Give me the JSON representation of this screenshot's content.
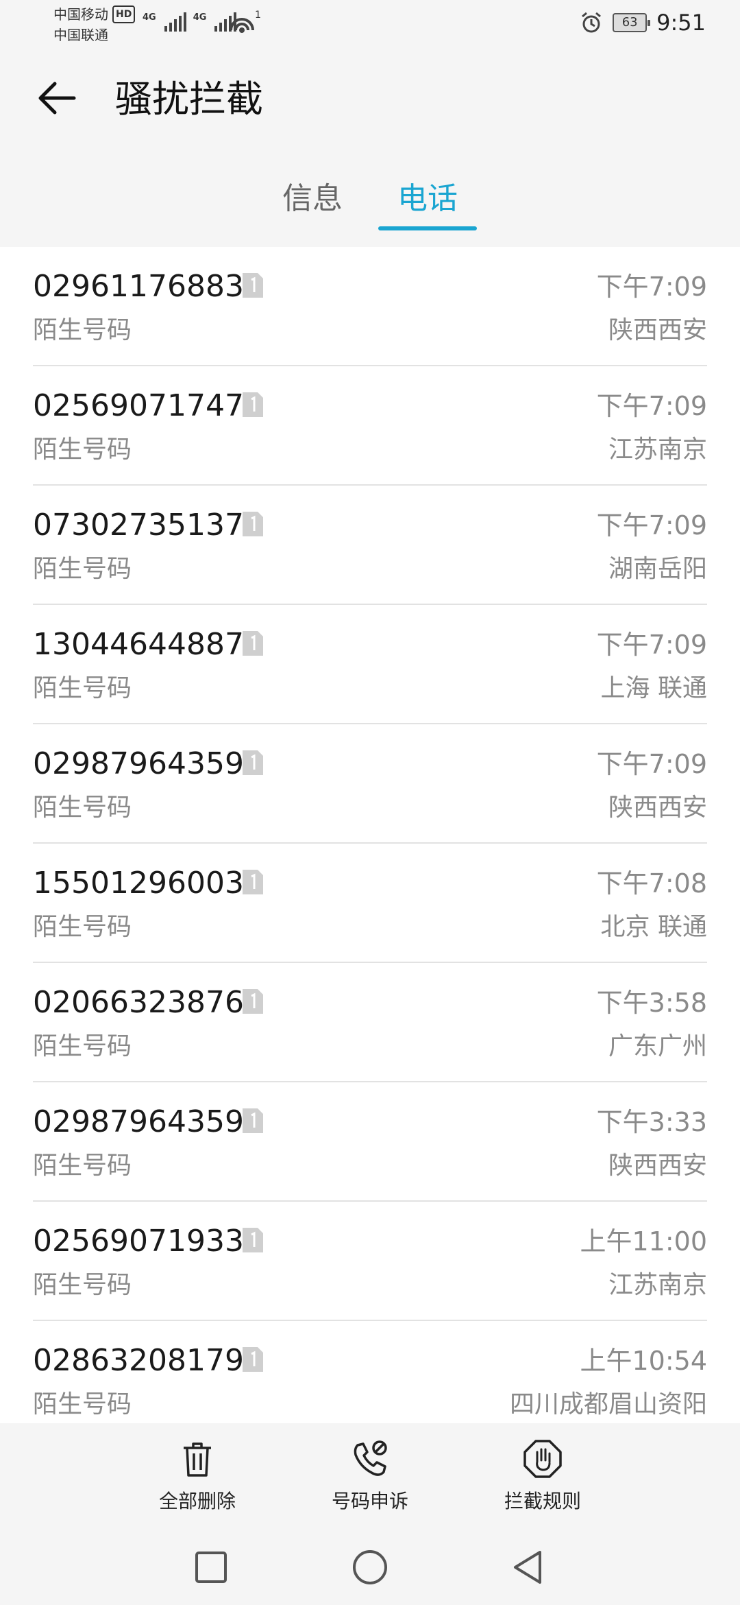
{
  "status_bar": {
    "carrier1": "中国移动",
    "carrier2": "中国联通",
    "hd": "HD",
    "net1": "4G",
    "net2": "4G",
    "hotspot_count": "1",
    "battery": "63",
    "time": "9:51"
  },
  "header": {
    "title": "骚扰拦截"
  },
  "tabs": [
    {
      "label": "信息",
      "active": false
    },
    {
      "label": "电话",
      "active": true
    }
  ],
  "colors": {
    "accent": "#1aa5d1",
    "secondary_text": "#8a8a8a",
    "list_bg": "#ffffff",
    "page_bg": "#f5f5f5"
  },
  "calls": [
    {
      "number": "02961176883",
      "label": "陌生号码",
      "time": "下午7:09",
      "location": "陕西西安"
    },
    {
      "number": "02569071747",
      "label": "陌生号码",
      "time": "下午7:09",
      "location": "江苏南京"
    },
    {
      "number": "07302735137",
      "label": "陌生号码",
      "time": "下午7:09",
      "location": "湖南岳阳"
    },
    {
      "number": "13044644887",
      "label": "陌生号码",
      "time": "下午7:09",
      "location": "上海 联通"
    },
    {
      "number": "02987964359",
      "label": "陌生号码",
      "time": "下午7:09",
      "location": "陕西西安"
    },
    {
      "number": "15501296003",
      "label": "陌生号码",
      "time": "下午7:08",
      "location": "北京 联通"
    },
    {
      "number": "02066323876",
      "label": "陌生号码",
      "time": "下午3:58",
      "location": "广东广州"
    },
    {
      "number": "02987964359",
      "label": "陌生号码",
      "time": "下午3:33",
      "location": "陕西西安"
    },
    {
      "number": "02569071933",
      "label": "陌生号码",
      "time": "上午11:00",
      "location": "江苏南京"
    },
    {
      "number": "02863208179",
      "label": "陌生号码",
      "time": "上午10:54",
      "location": "四川成都眉山资阳"
    }
  ],
  "actions": {
    "delete_all": "全部删除",
    "appeal": "号码申诉",
    "rules": "拦截规则"
  },
  "icons": {
    "back": "arrow-left-icon",
    "sim": "sim-card-1-icon",
    "delete": "trash-icon",
    "appeal": "phone-block-icon",
    "rules": "hand-stop-icon",
    "nav_recent": "square-icon",
    "nav_home": "circle-icon",
    "nav_back": "triangle-back-icon"
  }
}
